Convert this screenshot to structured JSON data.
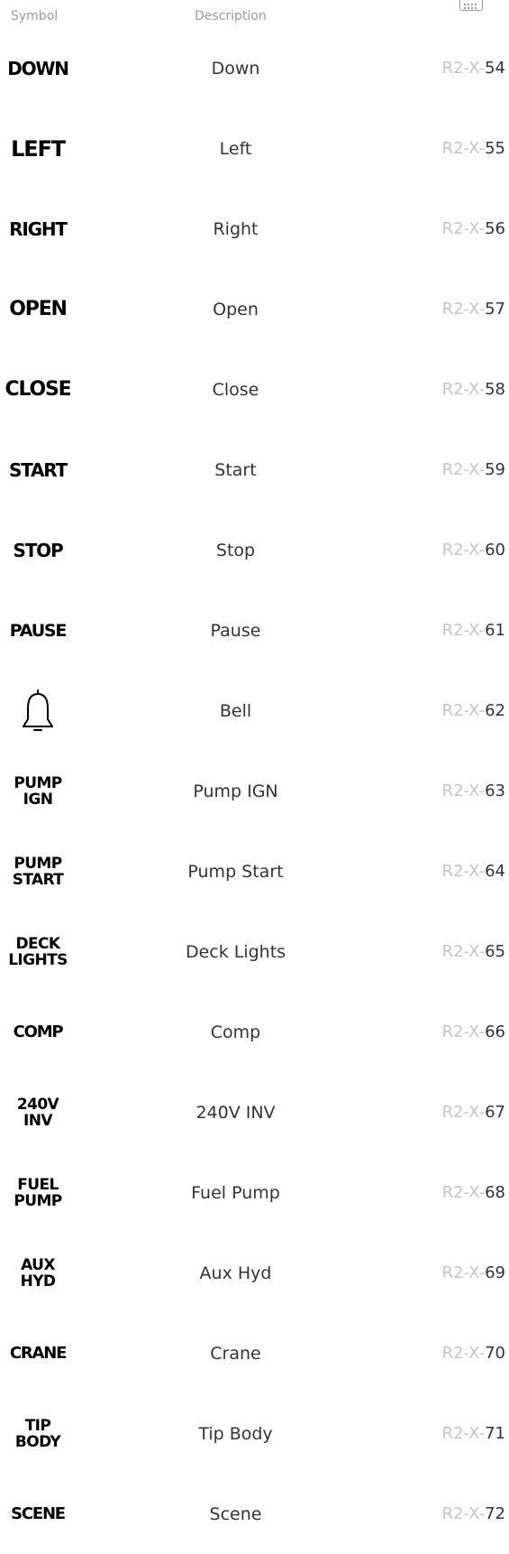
{
  "header": {
    "symbol_label": "Symbol",
    "description_label": "Description",
    "icon": "keyboard-icon"
  },
  "rows": [
    {
      "symbol": "DOWN",
      "description": "Down",
      "code_prefix": "R2-X-",
      "code_num": "54"
    },
    {
      "symbol": "LEFT",
      "description": "Left",
      "code_prefix": "R2-X-",
      "code_num": "55"
    },
    {
      "symbol": "RIGHT",
      "description": "Right",
      "code_prefix": "R2-X-",
      "code_num": "56"
    },
    {
      "symbol": "OPEN",
      "description": "Open",
      "code_prefix": "R2-X-",
      "code_num": "57"
    },
    {
      "symbol": "CLOSE",
      "description": "Close",
      "code_prefix": "R2-X-",
      "code_num": "58"
    },
    {
      "symbol": "START",
      "description": "Start",
      "code_prefix": "R2-X-",
      "code_num": "59"
    },
    {
      "symbol": "STOP",
      "description": "Stop",
      "code_prefix": "R2-X-",
      "code_num": "60"
    },
    {
      "symbol": "PAUSE",
      "description": "Pause",
      "code_prefix": "R2-X-",
      "code_num": "61"
    },
    {
      "symbol": "",
      "symbol_icon": "bell-icon",
      "description": "Bell",
      "code_prefix": "R2-X-",
      "code_num": "62"
    },
    {
      "symbol": "PUMP\nIGN",
      "description": "Pump IGN",
      "code_prefix": "R2-X-",
      "code_num": "63"
    },
    {
      "symbol": "PUMP\nSTART",
      "description": "Pump Start",
      "code_prefix": "R2-X-",
      "code_num": "64"
    },
    {
      "symbol": "DECK\nLIGHTS",
      "description": "Deck Lights",
      "code_prefix": "R2-X-",
      "code_num": "65"
    },
    {
      "symbol": "COMP",
      "description": "Comp",
      "code_prefix": "R2-X-",
      "code_num": "66"
    },
    {
      "symbol": "240V\nINV",
      "description": "240V INV",
      "code_prefix": "R2-X-",
      "code_num": "67"
    },
    {
      "symbol": "FUEL\nPUMP",
      "description": "Fuel Pump",
      "code_prefix": "R2-X-",
      "code_num": "68"
    },
    {
      "symbol": "AUX\nHYD",
      "description": "Aux Hyd",
      "code_prefix": "R2-X-",
      "code_num": "69"
    },
    {
      "symbol": "CRANE",
      "description": "Crane",
      "code_prefix": "R2-X-",
      "code_num": "70"
    },
    {
      "symbol": "TIP\nBODY",
      "description": "Tip Body",
      "code_prefix": "R2-X-",
      "code_num": "71"
    },
    {
      "symbol": "SCENE",
      "description": "Scene",
      "code_prefix": "R2-X-",
      "code_num": "72"
    }
  ]
}
